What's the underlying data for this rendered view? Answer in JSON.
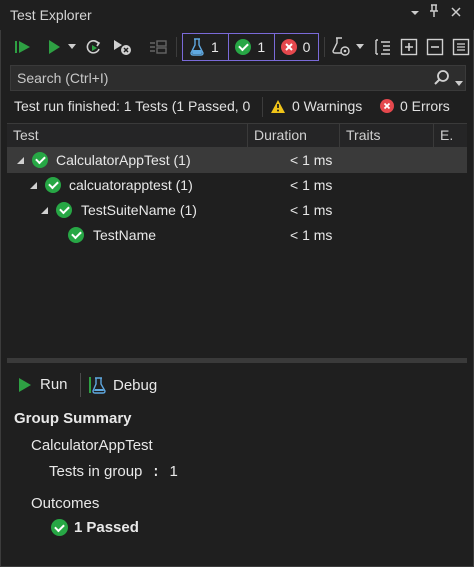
{
  "window": {
    "title": "Test Explorer"
  },
  "toolbar": {
    "filters": {
      "total": "1",
      "passed": "1",
      "failed": "0"
    }
  },
  "search": {
    "placeholder": "Search (Ctrl+I)"
  },
  "status": {
    "summary": "Test run finished: 1 Tests (1 Passed, 0",
    "warnings": "0 Warnings",
    "errors": "0 Errors"
  },
  "grid": {
    "columns": [
      "Test",
      "Duration",
      "Traits",
      "E."
    ],
    "rows": [
      {
        "name": "CalculatorAppTest  (1)",
        "duration": "< 1 ms"
      },
      {
        "name": "calcuatorapptest  (1)",
        "duration": "< 1 ms"
      },
      {
        "name": "TestSuiteName  (1)",
        "duration": "< 1 ms"
      },
      {
        "name": "TestName",
        "duration": "< 1 ms"
      }
    ]
  },
  "details": {
    "run_label": "Run",
    "debug_label": "Debug",
    "heading": "Group Summary",
    "group_name": "CalculatorAppTest",
    "tests_in_group_label": "Tests in group",
    "tests_in_group_value": "1",
    "outcomes_label": "Outcomes",
    "passed_count": "1",
    "passed_label": "Passed"
  },
  "colors": {
    "background": "#1f1f1f",
    "accent": "#7a6ad8",
    "passed": "#27a745",
    "failed": "#e5484d",
    "warning": "#f0c419"
  }
}
